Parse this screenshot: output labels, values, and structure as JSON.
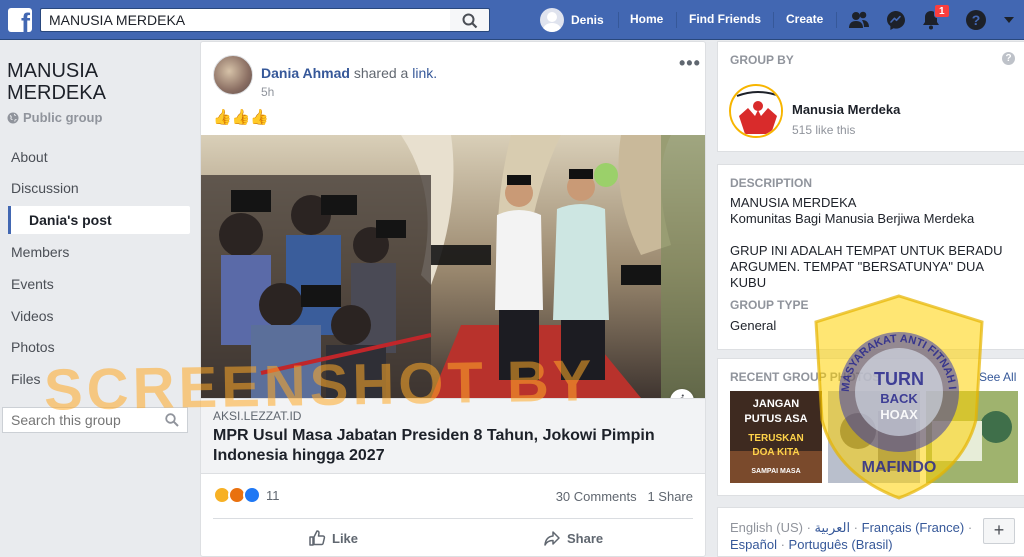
{
  "topbar": {
    "search_value": "MANUSIA MERDEKA",
    "user_name": "Denis",
    "links": [
      "Home",
      "Find Friends",
      "Create"
    ],
    "notification_count": "1"
  },
  "sidebar": {
    "group_name": "MANUSIA MERDEKA",
    "privacy": "Public group",
    "items": [
      {
        "label": "About"
      },
      {
        "label": "Discussion"
      },
      {
        "label": "Dania's post"
      },
      {
        "label": "Members"
      },
      {
        "label": "Events"
      },
      {
        "label": "Videos"
      },
      {
        "label": "Photos"
      },
      {
        "label": "Files"
      }
    ],
    "search_placeholder": "Search this group"
  },
  "post": {
    "author": "Dania Ahmad",
    "action_text": "shared a",
    "link_word": "link.",
    "time": "5h",
    "emoji": "👍👍👍",
    "link_domain": "AKSI.LEZZAT.ID",
    "link_title": "MPR Usul Masa Jabatan Presiden 8 Tahun, Jokowi Pimpin Indonesia hingga 2027",
    "reaction_count": "11",
    "comments": "30 Comments",
    "shares": "1 Share",
    "like_label": "Like",
    "share_label": "Share"
  },
  "right": {
    "group_by_title": "GROUP BY",
    "page_name": "Manusia Merdeka",
    "page_likes": "515 like this",
    "description_title": "DESCRIPTION",
    "description_lines": [
      "MANUSIA MERDEKA",
      "Komunitas Bagi Manusia Berjiwa Merdeka",
      "GRUP INI ADALAH TEMPAT UNTUK BERADU ARGUMEN. TEMPAT \"BERSATUNYA\" DUA KUBU"
    ],
    "group_type_title": "GROUP TYPE",
    "group_type": "General",
    "photos_title": "RECENT GROUP PHOTOS",
    "see_all": "See All",
    "photo1_lines": [
      "JANGAN",
      "PUTUS ASA",
      "TERUSKAN",
      "DOA KITA",
      "SAMPAI MASA"
    ],
    "languages": [
      "English (US)",
      "العربية",
      "Français (France)",
      "Español",
      "Português (Brasil)"
    ],
    "plus_label": "+"
  },
  "watermark": {
    "text": "SCREENSHOT BY",
    "badge_lines": [
      "TURN",
      "BACK",
      "HOAX"
    ],
    "badge_ring": "MASYARAKAT ANTI FITNAH INDONESIA",
    "badge_bottom": "MAFINDO"
  },
  "colors": {
    "brand": "#4267b2",
    "link": "#365899",
    "watermark": "#ffaa28"
  }
}
